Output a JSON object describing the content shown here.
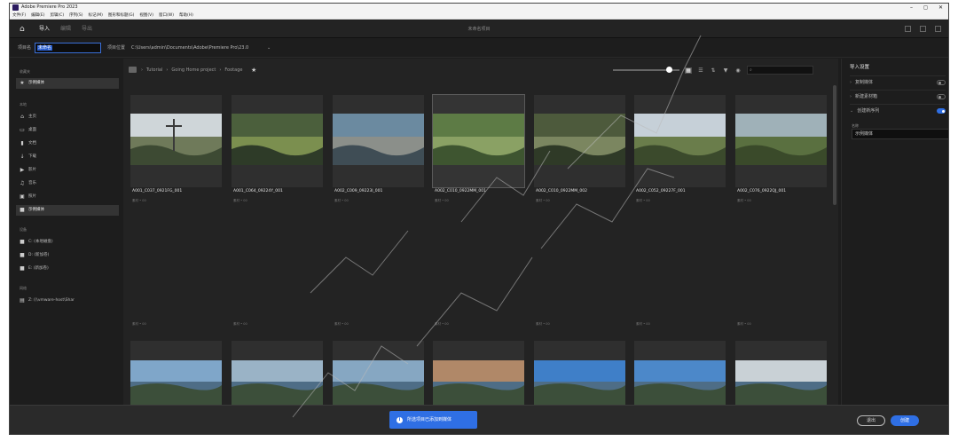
{
  "window": {
    "title": "Adobe Premiere Pro 2023",
    "controls": [
      "–",
      "◻",
      "✕"
    ]
  },
  "menu": [
    "文件(F)",
    "编辑(E)",
    "剪辑(C)",
    "序列(S)",
    "标记(M)",
    "图形和标题(G)",
    "视图(V)",
    "窗口(W)",
    "帮助(H)"
  ],
  "nav": {
    "tabs": [
      {
        "label": "导入",
        "active": true
      },
      {
        "label": "编辑",
        "active": false
      },
      {
        "label": "导出",
        "active": false
      }
    ],
    "center_title": "未命名项目"
  },
  "project": {
    "name_label": "项目名",
    "name_value": "未命名",
    "location_label": "项目位置",
    "location_value": "C:\\Users\\admin\\Documents\\Adobe\\Premiere Pro\\23.0"
  },
  "sidebar": {
    "section_recent": "收藏夹",
    "recent_items": [
      {
        "label": "示例媒体",
        "icon": "star-icon",
        "active": false
      }
    ],
    "section_local": "本地",
    "local_items": [
      {
        "label": "主页",
        "icon": "home-icon",
        "active": false
      },
      {
        "label": "桌面",
        "icon": "desktop-icon",
        "active": false
      },
      {
        "label": "文档",
        "icon": "document-icon",
        "active": false
      },
      {
        "label": "下载",
        "icon": "download-icon",
        "active": false
      },
      {
        "label": "影片",
        "icon": "video-icon",
        "active": false
      },
      {
        "label": "音乐",
        "icon": "music-icon",
        "active": false
      },
      {
        "label": "照片",
        "icon": "photo-icon",
        "active": false
      },
      {
        "label": "示例媒体",
        "icon": "folder-icon",
        "active": true
      }
    ],
    "section_devices": "设备",
    "device_items": [
      {
        "label": "C: (本地磁盘)",
        "icon": "drive-icon"
      },
      {
        "label": "D: (新加卷)",
        "icon": "drive-icon"
      },
      {
        "label": "E: (新加卷)",
        "icon": "drive-icon"
      }
    ],
    "section_network": "网络",
    "network_items": [
      {
        "label": "Z: (\\\\vmware-host\\Shar",
        "icon": "network-drive-icon"
      }
    ]
  },
  "breadcrumb": [
    "Tutorial",
    "Going Home project",
    "Footage"
  ],
  "toolbar": {
    "search_placeholder": "",
    "zoom_level": 0.88
  },
  "clips_row1": [
    {
      "title": "A001_C037_0921FG_001",
      "meta": "素材 • 00",
      "scene": "cross"
    },
    {
      "title": "A001_C064_09224Y_001",
      "meta": "素材 • 00",
      "scene": "field"
    },
    {
      "title": "A002_C009_09223I_001",
      "meta": "素材 • 00",
      "scene": "city"
    },
    {
      "title": "A002_C010_0922MM_001",
      "meta": "素材 • 00",
      "scene": "jungle"
    },
    {
      "title": "A002_C010_0922MM_002",
      "meta": "素材 • 00",
      "scene": "jungle2"
    },
    {
      "title": "A002_C052_09227F_001",
      "meta": "素材 • 00",
      "scene": "tree"
    },
    {
      "title": "A002_C076_0922QJ_001",
      "meta": "素材 • 00",
      "scene": "fence"
    }
  ],
  "row2_meta": [
    "素材 • 00",
    "素材 • 00",
    "素材 • 00",
    "素材 • 00",
    "素材 • 00",
    "素材 • 00",
    "素材 • 00"
  ],
  "right_panel": {
    "title": "导入设置",
    "rows": [
      {
        "label": "复制媒体",
        "on": false
      },
      {
        "label": "新建素材箱",
        "on": false
      },
      {
        "label": "创建新序列",
        "on": true
      }
    ],
    "name_label": "名称",
    "name_value": "示例媒体"
  },
  "footer": {
    "toast": "所选项目已添加到媒体",
    "exit": "退出",
    "create": "创建"
  },
  "colors": {
    "accent": "#2f6fe4",
    "bg": "#1d1d1d"
  }
}
